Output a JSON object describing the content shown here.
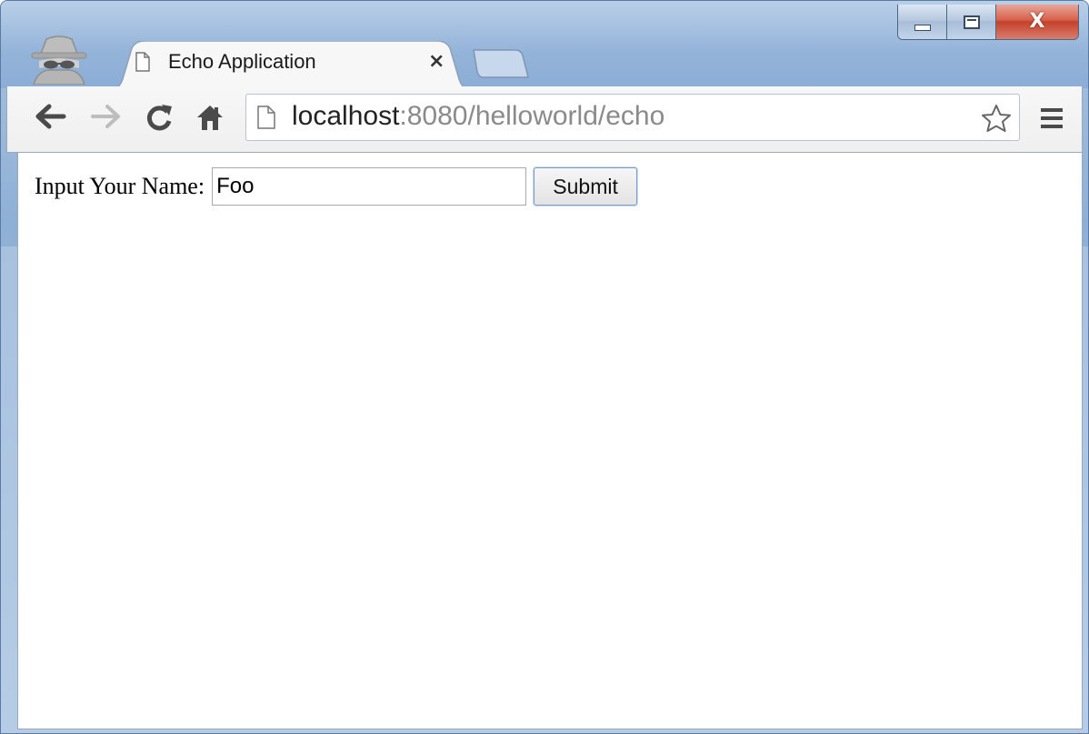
{
  "window": {
    "controls": {
      "minimize": "minimize",
      "maximize": "maximize",
      "close": "x"
    }
  },
  "tab": {
    "title": "Echo Application",
    "close_label": "×"
  },
  "toolbar": {
    "back_icon": "back-arrow-icon",
    "forward_icon": "forward-arrow-icon",
    "reload_icon": "reload-icon",
    "home_icon": "home-icon",
    "url_host": "localhost",
    "url_rest": ":8080/helloworld/echo",
    "bookmark_icon": "star-icon",
    "menu_icon": "hamburger-menu-icon"
  },
  "form": {
    "label": "Input Your Name:",
    "input_value": "Foo",
    "submit_label": "Submit"
  },
  "colors": {
    "frame": "#8fb0d6",
    "close_button": "#c4412b",
    "url_rest": "#8a8a8a"
  }
}
